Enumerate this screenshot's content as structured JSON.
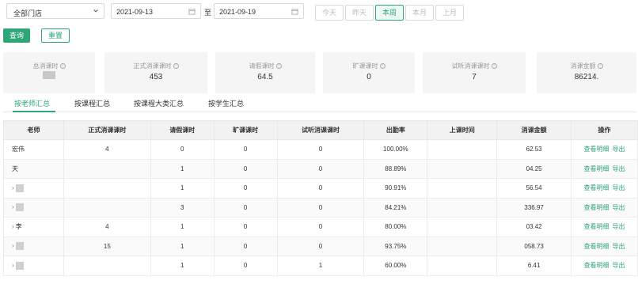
{
  "filters": {
    "store_select": "全部门店",
    "date_start": "2021-09-13",
    "date_separator": "至",
    "date_end": "2021-09-19",
    "quick": [
      "今天",
      "昨天",
      "本周",
      "本月",
      "上月"
    ],
    "quick_active_index": 2
  },
  "actions": {
    "query": "查询",
    "reset": "重置"
  },
  "summary": [
    {
      "label": "总消课时",
      "value": ""
    },
    {
      "label": "正式消课课时",
      "value": "453"
    },
    {
      "label": "请假课时",
      "value": "64.5"
    },
    {
      "label": "旷课课时",
      "value": "0"
    },
    {
      "label": "试听消课课时",
      "value": "7"
    },
    {
      "label": "消课金额",
      "value": "86214."
    }
  ],
  "tabs": [
    "按老师汇总",
    "按课程汇总",
    "按课程大类汇总",
    "按学生汇总"
  ],
  "table": {
    "headers": [
      "老师",
      "正式消课课时",
      "请假课时",
      "旷课课时",
      "试听消课课时",
      "出勤率",
      "上课时间",
      "消课金额",
      "操作"
    ],
    "rows": [
      {
        "teacher": "宏伟",
        "formal": "4",
        "leave": "0",
        "absent": "0",
        "trial": "0",
        "rate": "100.00%",
        "time": "",
        "amount": "62.53"
      },
      {
        "teacher": "天",
        "formal": "",
        "leave": "1",
        "absent": "0",
        "trial": "0",
        "rate": "88.89%",
        "time": "",
        "amount": "04.25"
      },
      {
        "teacher": "",
        "formal": "",
        "leave": "1",
        "absent": "0",
        "trial": "0",
        "rate": "90.91%",
        "time": "",
        "amount": "56.54"
      },
      {
        "teacher": "",
        "formal": "",
        "leave": "3",
        "absent": "0",
        "trial": "0",
        "rate": "84.21%",
        "time": "",
        "amount": "336.97"
      },
      {
        "teacher": "李",
        "formal": "4",
        "leave": "1",
        "absent": "0",
        "trial": "0",
        "rate": "80.00%",
        "time": "",
        "amount": "03.42"
      },
      {
        "teacher": "",
        "formal": "15",
        "leave": "1",
        "absent": "0",
        "trial": "0",
        "rate": "93.75%",
        "time": "",
        "amount": "058.73"
      },
      {
        "teacher": "",
        "formal": "",
        "leave": "1",
        "absent": "0",
        "trial": "1",
        "rate": "60.00%",
        "time": "",
        "amount": "6.41"
      }
    ],
    "op_detail": "查看明细",
    "op_export": "导出"
  },
  "colors": {
    "accent": "#2fa678"
  }
}
